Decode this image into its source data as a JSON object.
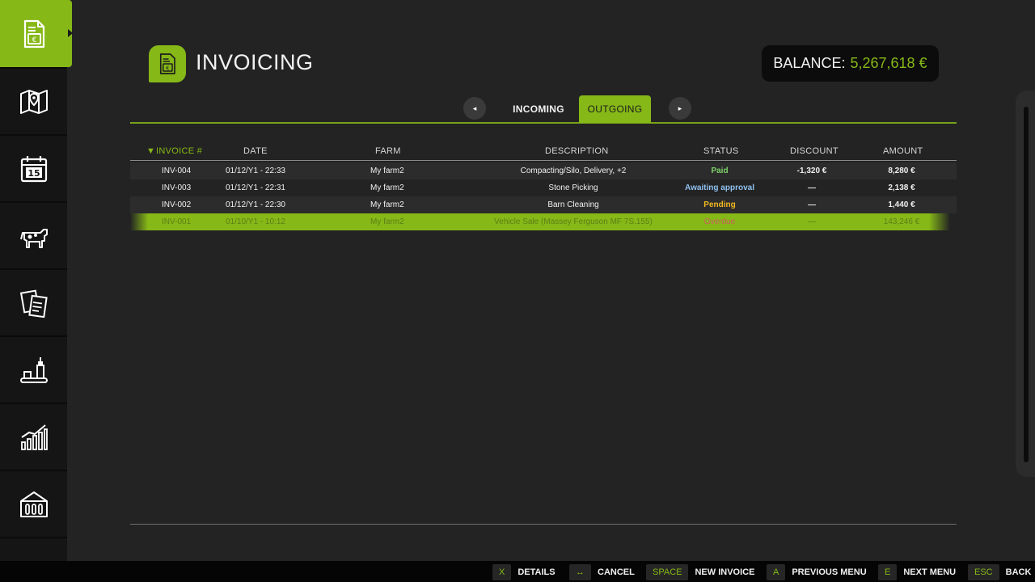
{
  "header": {
    "title": "INVOICING",
    "balance_label": "BALANCE:",
    "balance_value": "5,267,618 €"
  },
  "sidebar": {
    "items": [
      {
        "name": "invoice-icon",
        "active": true
      },
      {
        "name": "map-icon",
        "active": false
      },
      {
        "name": "calendar-icon",
        "active": false
      },
      {
        "name": "animals-icon",
        "active": false
      },
      {
        "name": "contracts-icon",
        "active": false
      },
      {
        "name": "production-icon",
        "active": false
      },
      {
        "name": "statistics-icon",
        "active": false
      },
      {
        "name": "farm-buildings-icon",
        "active": false
      },
      {
        "name": "more-icon",
        "active": false
      }
    ],
    "calendar_day": "15"
  },
  "tabs": {
    "prev_arrow": "◂",
    "next_arrow": "▸",
    "incoming": "INCOMING",
    "outgoing": "OUTGOING",
    "active": "OUTGOING"
  },
  "table": {
    "sort_indicator": "▼",
    "columns": [
      "INVOICE #",
      "DATE",
      "FARM",
      "DESCRIPTION",
      "STATUS",
      "DISCOUNT",
      "AMOUNT"
    ],
    "rows": [
      {
        "invoice": "INV-004",
        "date": "01/12/Y1 - 22:33",
        "farm": "My farm2",
        "description": "Compacting/Silo, Delivery, +2",
        "status": "Paid",
        "discount": "-1,320 €",
        "amount": "8,280 €"
      },
      {
        "invoice": "INV-003",
        "date": "01/12/Y1 - 22:31",
        "farm": "My farm2",
        "description": "Stone Picking",
        "status": "Awaiting approval",
        "discount": "—",
        "amount": "2,138 €"
      },
      {
        "invoice": "INV-002",
        "date": "01/12/Y1 - 22:30",
        "farm": "My farm2",
        "description": "Barn Cleaning",
        "status": "Pending",
        "discount": "—",
        "amount": "1,440 €"
      },
      {
        "invoice": "INV-001",
        "date": "01/10/Y1 - 10:12",
        "farm": "My farm2",
        "description": "Vehicle Sale (Massey Ferguson MF 7S.155)",
        "status": "Overdue",
        "discount": "—",
        "amount": "143,246 €"
      }
    ],
    "status_colors": {
      "Paid": "#7fd26a",
      "Awaiting approval": "#8fc1f0",
      "Pending": "#f2b820",
      "Overdue": "#c9605c"
    },
    "selected_index": 3
  },
  "footer": {
    "hints": [
      {
        "key": "X",
        "label": "DETAILS"
      },
      {
        "key": "↔",
        "label": "CANCEL"
      },
      {
        "key": "SPACE",
        "label": "NEW INVOICE"
      },
      {
        "key": "A",
        "label": "PREVIOUS MENU"
      },
      {
        "key": "E",
        "label": "NEXT MENU"
      },
      {
        "key": "ESC",
        "label": "BACK"
      }
    ]
  },
  "colors": {
    "accent": "#86b817",
    "background": "#232323",
    "sidebar": "#151515"
  }
}
